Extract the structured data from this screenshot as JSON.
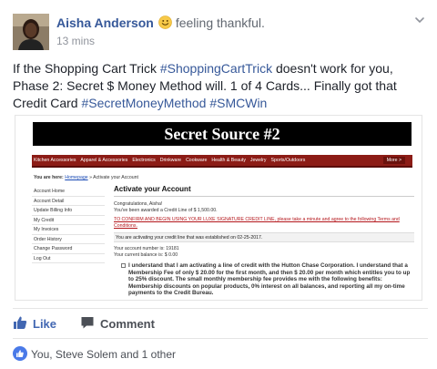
{
  "post": {
    "author": "Aisha Anderson",
    "feeling": "feeling thankful.",
    "timestamp": "13 mins",
    "text": {
      "part1": "If the Shopping Cart Trick ",
      "tag1": "#ShoppingCartTrick",
      "part2": " doesn't work for you, Phase 2: Secret $ Money Method will. 1 of 4 Cards... Finally got that Credit Card ",
      "tag2": "#SecretMoneyMethod",
      "tag3": "#SMCWin"
    }
  },
  "attachment": {
    "banner": "Secret Source #2",
    "nav": [
      "Kitchen Accessories",
      "Apparel & Accessories",
      "Electronics",
      "Drinkware",
      "Cookware",
      "Health & Beauty",
      "Jewelry",
      "Sports/Outdoors"
    ],
    "nav_more": "More >",
    "breadcrumb": {
      "prefix": "You are here:",
      "home": "Homepage",
      "current": "» Activate your Account"
    },
    "account_menu": [
      "Account Home",
      "Account Detail",
      "Update Billing Info",
      "My Credit",
      "My Invoices",
      "Order History",
      "Change Password",
      "Log Out"
    ],
    "title": "Activate your Account",
    "congrats": "Congratulations, Aisha!",
    "awarded": "You've been awarded a Credit Line of $ 1,500.00.",
    "confirm": "TO CONFIRM AND BEGIN USING YOUR LUXE SIGNATURE CREDIT LINE, please take a minute and agree to the following Terms and Conditions.",
    "activating": "You are activating your credit line that was established on 02-25-2017.",
    "account_number": "Your account number is: 19181",
    "balance": "Your current balance is: $ 0.00",
    "agreement": "I understand that I am activating a line of credit with the Hutton Chase Corporation. I understand that a Membership Fee of only $ 20.00 for the first month, and then $ 20.00 per month which entitles you to up to 25% discount. The small monthly membership fee provides me with the following benefits: Membership discounts on popular products, 0% interest on all balances, and reporting all my on-time payments to the Credit Bureau."
  },
  "actions": {
    "like": "Like",
    "comment": "Comment"
  },
  "reactions": {
    "summary": "You, Steve Solem and 1 other"
  },
  "colors": {
    "link": "#365899",
    "like_blue": "#4267b2",
    "nav_red": "#8c1c16"
  }
}
